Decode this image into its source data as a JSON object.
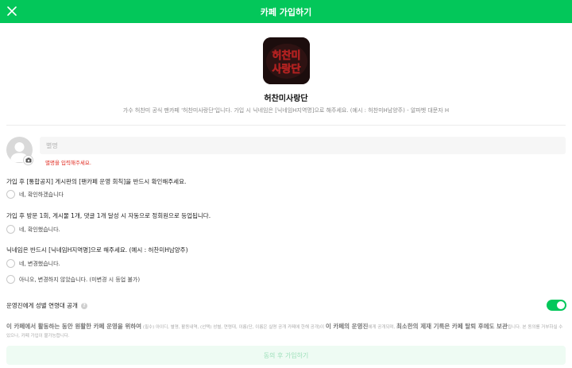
{
  "header": {
    "title": "카페 가입하기",
    "close_icon": "close-icon",
    "brand_color": "#03c75a"
  },
  "cafe": {
    "logo_text": "허찬미사랑단",
    "name": "허찬미사랑단",
    "description": "가수 허찬미 공식 팬카페 '허찬미사랑단'입니다. 가입 시 닉네임은 [닉네임H지역명]으로 해주세요. (예시 : 허찬미H남양주) - 알파벳 대문자 H"
  },
  "profile": {
    "avatar_icon": "user-avatar-icon",
    "camera_icon": "camera-icon"
  },
  "nickname": {
    "placeholder": "별명",
    "value": "",
    "error": "별명을 입력해주세요."
  },
  "questions": [
    {
      "text": "가입 후 [통합공지] 게시판의 [팬카페 운영 회칙]을 반드시 확인해주세요.",
      "options": [
        "네, 확인하겠습니다"
      ]
    },
    {
      "text": "가입 후 방문 1회, 게시물 1개, 댓글 1개 달성 시 자동으로 정회원으로 등업됩니다.",
      "options": [
        "네, 확인했습니다."
      ]
    },
    {
      "text": "닉네임은 반드시 [닉네임H지역명]으로 해주세요. (예시 : 허찬미H남양주)",
      "options": [
        "네, 변경했습니다.",
        "아니오, 변경하지 않았습니다. (미변경 시 등업 불가)"
      ]
    }
  ],
  "gender_age": {
    "label": "운영진에게 성별 연령대 공개",
    "help": "?",
    "enabled": true
  },
  "notice": {
    "part1": "이 카페에서 활동하는 동안 원활한 카페 운영을 위하여",
    "part2": " (필수) 아이디, 별명, 활동내역, (선택) 성별, 연령대, 이름(단, 이름은 실명 공개 카페에 한해 공개)이 ",
    "part3": "이 카페의 운영진",
    "part4": "에게 공개되며, ",
    "part5": "최소한의 제재 기록은 카페 탈퇴 후에도 보관",
    "part6": "됩니다. 본 동의를 거부하실 수 있으나, 카페 가입이 불가능합니다."
  },
  "submit": {
    "label": "동의 후 가입하기"
  }
}
